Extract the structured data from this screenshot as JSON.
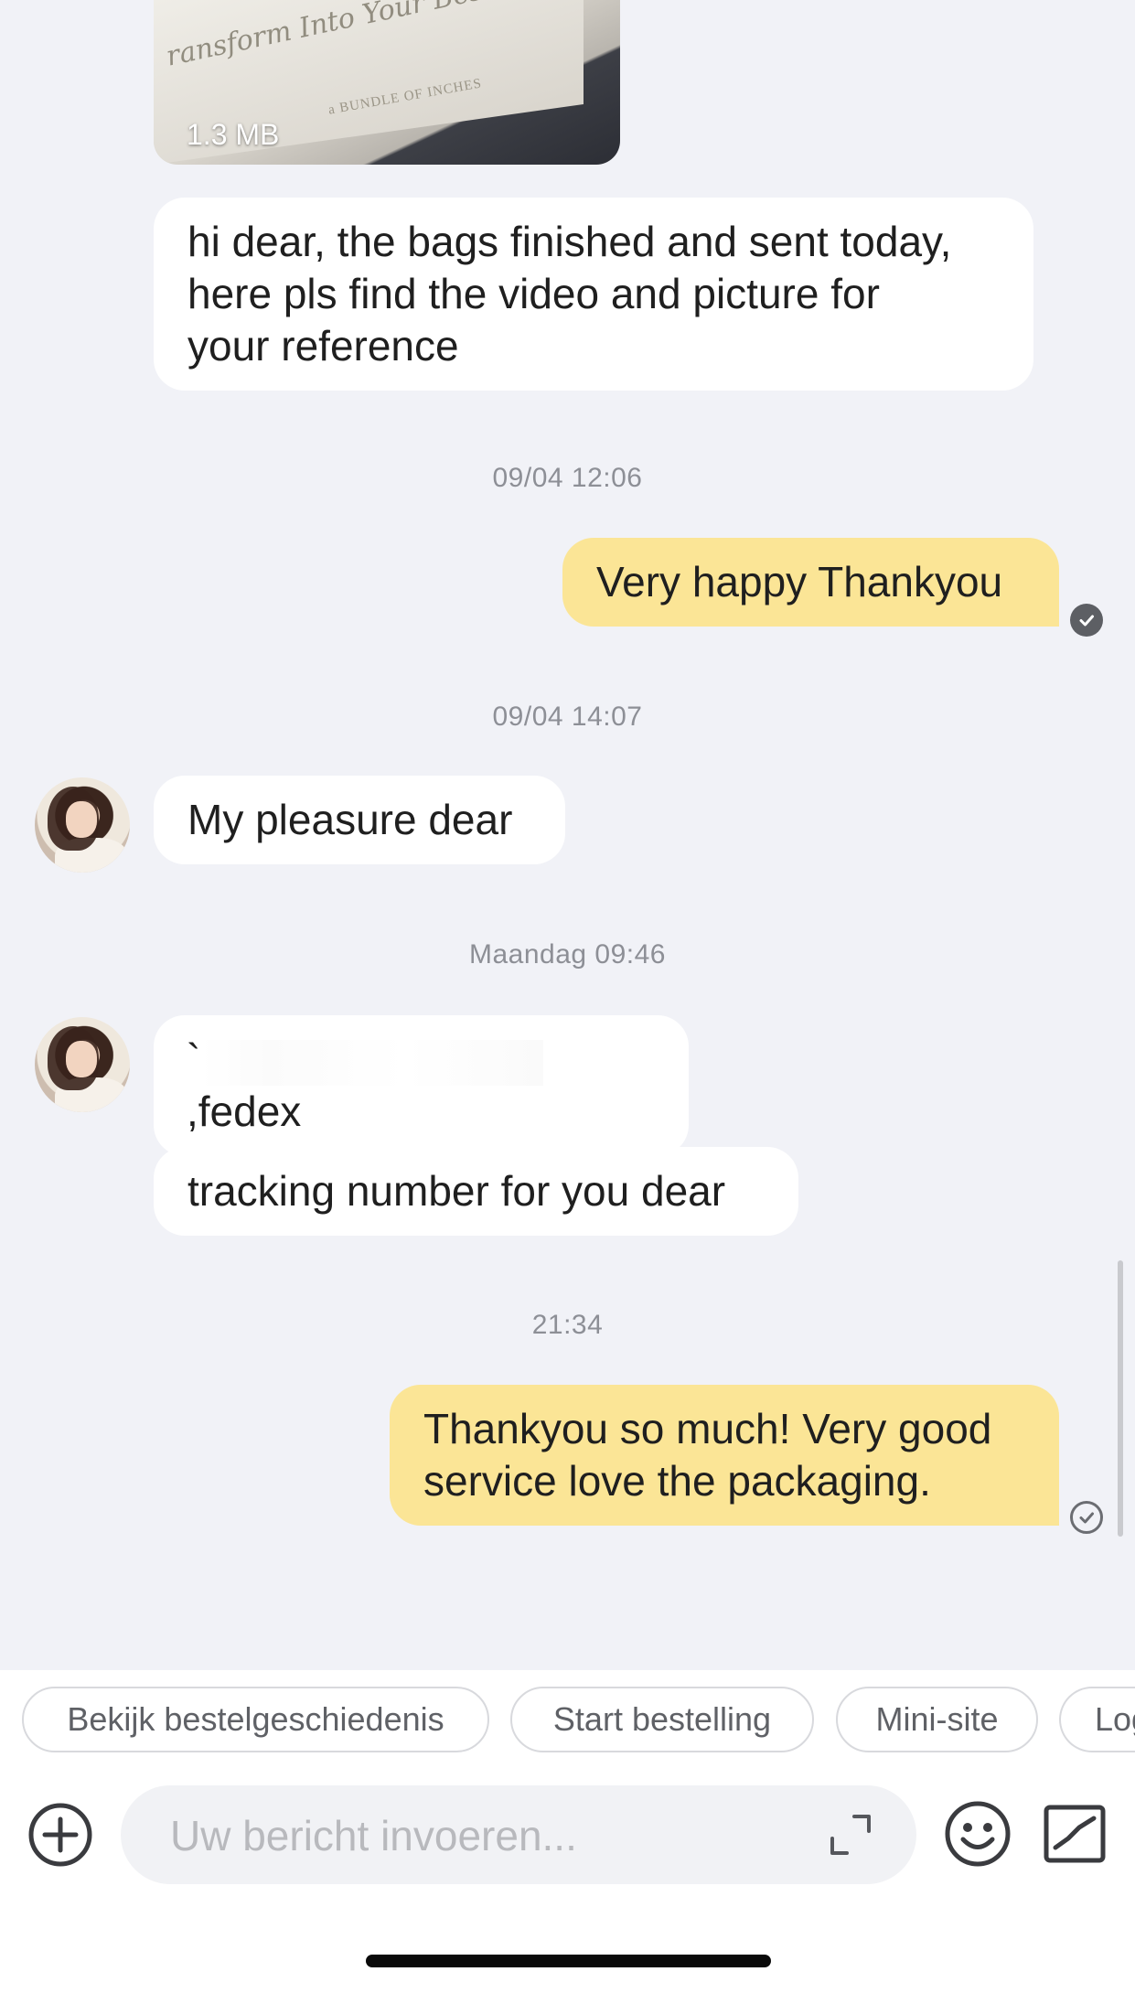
{
  "messages": [
    {
      "kind": "media",
      "size_label": "1.3 MB",
      "script_text": "ransform Into Your Best S",
      "print_text": "a BUNDLE OF INCHES"
    },
    {
      "kind": "incoming",
      "text": "hi dear, the bags finished and sent today,\nhere pls find the video and picture for\nyour reference"
    },
    {
      "kind": "timestamp",
      "text": "09/04 12:06"
    },
    {
      "kind": "outgoing",
      "text": "Very happy Thankyou",
      "status": "read"
    },
    {
      "kind": "timestamp",
      "text": "09/04 14:07"
    },
    {
      "kind": "incoming",
      "text": "My pleasure dear"
    },
    {
      "kind": "timestamp",
      "text": "Maandag 09:46"
    },
    {
      "kind": "incoming",
      "text_prefix": "`",
      "text_suffix": ",fedex",
      "redacted": true
    },
    {
      "kind": "incoming",
      "text": "tracking number for you dear"
    },
    {
      "kind": "timestamp",
      "text": "21:34"
    },
    {
      "kind": "outgoing",
      "text": "Thankyou so much! Very good\nservice love the packaging.",
      "status": "sent"
    }
  ],
  "quick_replies": [
    "Bekijk bestelgeschiedenis",
    "Start bestelling",
    "Mini-site",
    "Log"
  ],
  "composer": {
    "placeholder": "Uw bericht invoeren...",
    "value": ""
  },
  "icons": {
    "add": "plus-circle-icon",
    "expand": "expand-icon",
    "emoji": "smiley-icon",
    "image": "image-icon",
    "read": "check-filled-icon",
    "sent": "check-outline-icon"
  },
  "colors": {
    "background": "#f1f2f7",
    "incoming_bubble": "#ffffff",
    "outgoing_bubble": "#fbe596",
    "timestamp": "#8d8f96",
    "chip_border": "#d8d9dd"
  }
}
